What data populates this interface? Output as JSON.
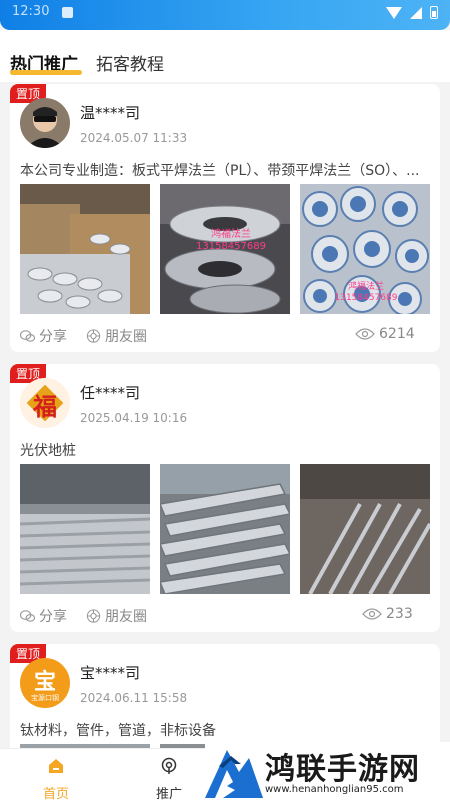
{
  "status_bar": {
    "time": "12:30"
  },
  "tabs": [
    {
      "label": "热门推广",
      "active": true
    },
    {
      "label": "拓客教程",
      "active": false
    }
  ],
  "posts": [
    {
      "badge": "置顶",
      "name": "温****司",
      "date": "2024.05.07 11:33",
      "description": "本公司专业制造：板式平焊法兰（PL）、带颈平焊法兰（SO）、...",
      "photo_captions": [
        "",
        "鸿福法兰 13158457689",
        "鸿福法兰 13158457689"
      ],
      "share_label": "分享",
      "moments_label": "朋友圈",
      "views": "6214"
    },
    {
      "badge": "置顶",
      "name": "任****司",
      "date": "2025.04.19 10:16",
      "description": "光伏地桩",
      "photo_captions": [
        "",
        "",
        ""
      ],
      "avatar_char": "福",
      "share_label": "分享",
      "moments_label": "朋友圈",
      "views": "233"
    },
    {
      "badge": "置顶",
      "name": "宝****司",
      "date": "2024.06.11 15:58",
      "description": "钛材料，管件，管道，非标设备",
      "avatar_char": "宝",
      "avatar_caption": "宝源口钢"
    }
  ],
  "tabbar": [
    {
      "label": "首页",
      "active": true
    },
    {
      "label": "推广",
      "active": false
    }
  ],
  "watermark": {
    "title": "鸿联手游网",
    "url": "www.henanhonglian95.com"
  },
  "colors": {
    "accent": "#f5b82e",
    "badge": "#e01e1e",
    "tab_active": "#f5a623",
    "status_bar": "#1e8ee9"
  }
}
